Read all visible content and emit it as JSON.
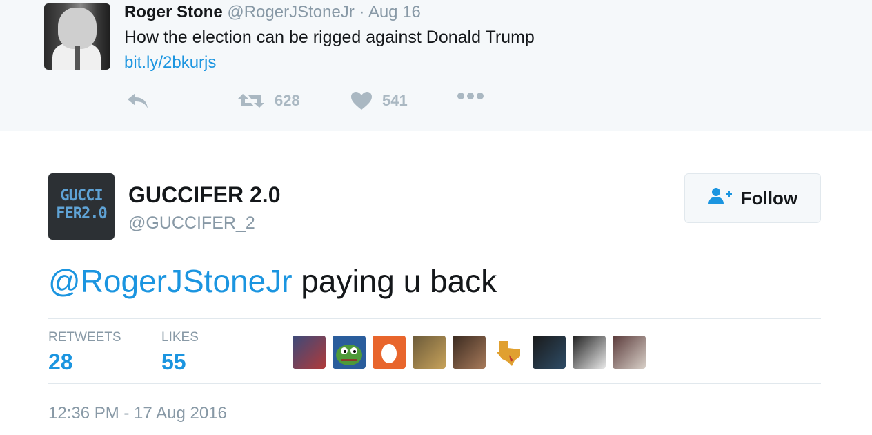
{
  "parent_tweet": {
    "name": "Roger Stone",
    "handle": "@RogerJStoneJr",
    "separator": "·",
    "date": "Aug 16",
    "text": "How the election can be rigged against Donald Trump",
    "link": "bit.ly/2bkurjs",
    "retweet_count": "628",
    "like_count": "541",
    "icons": [
      "reply-icon",
      "retweet-icon",
      "heart-icon",
      "more-icon"
    ]
  },
  "tweet": {
    "avatar_text_line1": "GUCCI",
    "avatar_text_line2": "FER2.0",
    "name": "GUCCIFER 2.0",
    "handle": "@GUCCIFER_2",
    "follow_label": "Follow",
    "mention": "@RogerJStoneJr",
    "text_rest": " paying u back",
    "stats": {
      "retweets_label": "RETWEETS",
      "retweets_value": "28",
      "likes_label": "LIKES",
      "likes_value": "55"
    },
    "timestamp": "12:36 PM - 17 Aug 2016"
  },
  "likers": [
    {
      "name": "liker-avatar-1",
      "colors": [
        "#3b4a7a",
        "#b03a3a"
      ]
    },
    {
      "name": "liker-avatar-pepe",
      "colors": [
        "#2a5d9c",
        "#4e9a3a"
      ]
    },
    {
      "name": "liker-avatar-egg",
      "colors": [
        "#e8652c",
        "#ffffff"
      ]
    },
    {
      "name": "liker-avatar-4",
      "colors": [
        "#6b5a3a",
        "#c7a25a"
      ]
    },
    {
      "name": "liker-avatar-5",
      "colors": [
        "#3a2a20",
        "#a77a5a"
      ]
    },
    {
      "name": "liker-avatar-texas",
      "colors": [
        "#ffffff",
        "#e0a030"
      ]
    },
    {
      "name": "liker-avatar-7",
      "colors": [
        "#1a1a1a",
        "#2e4c66"
      ]
    },
    {
      "name": "liker-avatar-8",
      "colors": [
        "#202020",
        "#e8e8e8"
      ]
    },
    {
      "name": "liker-avatar-9",
      "colors": [
        "#5a3a3a",
        "#d8d0c8"
      ]
    }
  ],
  "colors": {
    "link_blue": "#1b95e0",
    "muted_gray": "#8899a6",
    "icon_gray": "#aab8c2",
    "parent_bg": "#f5f8fa"
  }
}
